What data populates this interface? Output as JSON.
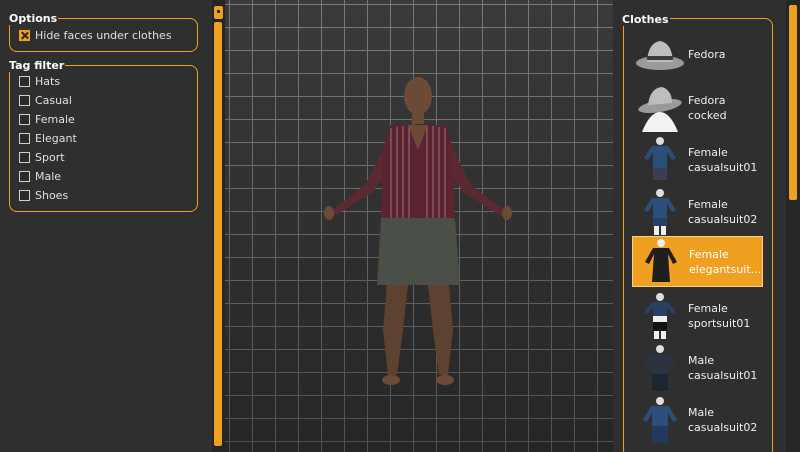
{
  "options": {
    "title": "Options",
    "hide_faces": {
      "label": "Hide faces under clothes",
      "checked": true
    }
  },
  "tag_filter": {
    "title": "Tag filter",
    "tags": [
      {
        "label": "Hats",
        "checked": false
      },
      {
        "label": "Casual",
        "checked": false
      },
      {
        "label": "Female",
        "checked": false
      },
      {
        "label": "Elegant",
        "checked": false
      },
      {
        "label": "Sport",
        "checked": false
      },
      {
        "label": "Male",
        "checked": false
      },
      {
        "label": "Shoes",
        "checked": false
      }
    ]
  },
  "clothes": {
    "title": "Clothes",
    "items": [
      {
        "label": "Fedora",
        "icon": "fedora-hat-icon",
        "selected": false
      },
      {
        "label": "Fedora\ncocked",
        "icon": "fedora-cocked-icon",
        "selected": false
      },
      {
        "label": "Female\ncasualsuit01",
        "icon": "female-casualsuit01-icon",
        "selected": false
      },
      {
        "label": "Female\ncasualsuit02",
        "icon": "female-casualsuit02-icon",
        "selected": false
      },
      {
        "label": "Female\nelegantsuit...",
        "icon": "female-elegantsuit-icon",
        "selected": true
      },
      {
        "label": "Female\nsportsuit01",
        "icon": "female-sportsuit01-icon",
        "selected": false
      },
      {
        "label": "Male\ncasualsuit01",
        "icon": "male-casualsuit01-icon",
        "selected": false
      },
      {
        "label": "Male\ncasualsuit02",
        "icon": "male-casualsuit02-icon",
        "selected": false
      }
    ]
  },
  "colors": {
    "accent": "#f0a020",
    "panel": "#2f2f2f",
    "viewport_grid": "#7a7a7a"
  }
}
